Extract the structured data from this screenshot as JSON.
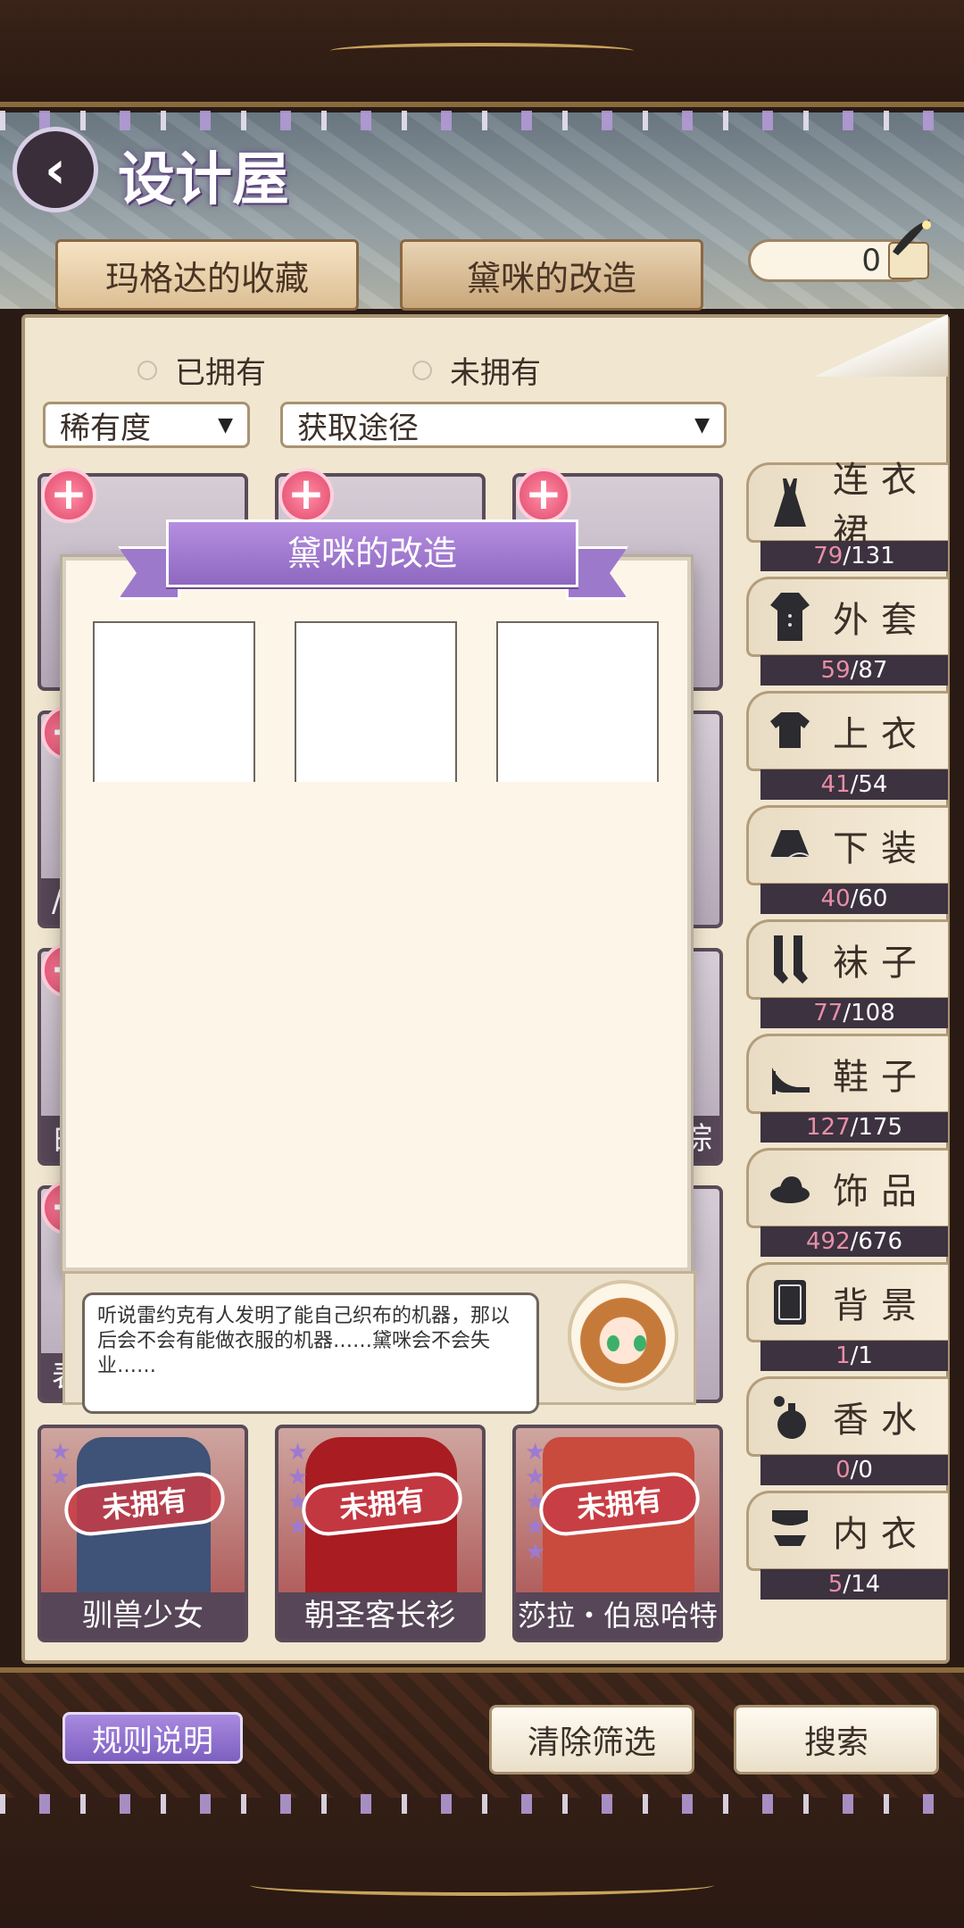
{
  "header": {
    "back_glyph": "‹",
    "title": "设计屋"
  },
  "tabs": [
    {
      "label": "玛格达的收藏",
      "active": false
    },
    {
      "label": "黛咪的改造",
      "active": true
    }
  ],
  "currency": {
    "value": "0"
  },
  "filters": {
    "radio": [
      "已拥有",
      "未拥有"
    ],
    "rarity": "稀有度",
    "source": "获取途径",
    "arrow": "▼"
  },
  "grid": {
    "partial_labels": [
      "/",
      "白",
      "表",
      "棕"
    ],
    "bottom_items": [
      {
        "label": "驯兽少女",
        "badge": "未拥有"
      },
      {
        "label": "朝圣客长衫",
        "badge": "未拥有"
      },
      {
        "label": "莎拉・伯恩哈特",
        "badge": "未拥有"
      }
    ]
  },
  "categories": [
    {
      "name": "连衣裙",
      "owned": "79",
      "total": "/131",
      "icon": "dress-icon"
    },
    {
      "name": "外套",
      "owned": "59",
      "total": "/87",
      "icon": "coat-icon"
    },
    {
      "name": "上衣",
      "owned": "41",
      "total": "/54",
      "icon": "top-icon"
    },
    {
      "name": "下装",
      "owned": "40",
      "total": "/60",
      "icon": "skirt-icon"
    },
    {
      "name": "袜子",
      "owned": "77",
      "total": "/108",
      "icon": "socks-icon"
    },
    {
      "name": "鞋子",
      "owned": "127",
      "total": "/175",
      "icon": "heel-icon"
    },
    {
      "name": "饰品",
      "owned": "492",
      "total": "/676",
      "icon": "hat-icon"
    },
    {
      "name": "背景",
      "owned": "1",
      "total": "/1",
      "icon": "background-icon"
    },
    {
      "name": "香水",
      "owned": "0",
      "total": "/0",
      "icon": "perfume-icon"
    },
    {
      "name": "内衣",
      "owned": "5",
      "total": "/14",
      "icon": "lingerie-icon"
    }
  ],
  "modal": {
    "title": "黛咪的改造",
    "speech": "听说雷约克有人发明了能自己织布的机器，那以后会不会有能做衣服的机器……黛咪会不会失业……"
  },
  "footer": {
    "rules": "规则说明",
    "clear": "清除筛选",
    "search": "搜索"
  },
  "colors": {
    "accent_purple": "#8e68c0",
    "owned_pink": "#e88ea6",
    "frame_brown": "#2a1a14"
  }
}
